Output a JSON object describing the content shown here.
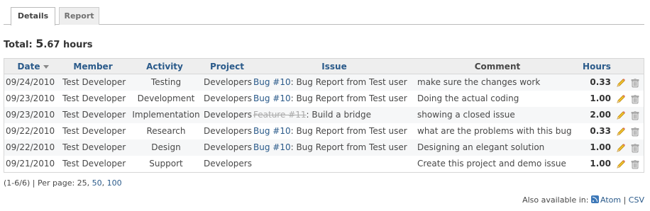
{
  "tabs": [
    {
      "label": "Details",
      "selected": true
    },
    {
      "label": "Report",
      "selected": false
    }
  ],
  "total": {
    "label": "Total:",
    "value_int": "5",
    "value_dec": ".67",
    "unit": "hours"
  },
  "table": {
    "headers": {
      "date": "Date",
      "member": "Member",
      "activity": "Activity",
      "project": "Project",
      "issue": "Issue",
      "comment": "Comment",
      "hours": "Hours"
    },
    "rows": [
      {
        "date": "09/24/2010",
        "member": "Test Developer",
        "activity": "Testing",
        "project": "Developers",
        "issue_link": "Bug #10",
        "issue_title": ": Bug Report from Test user",
        "comment": "make sure the changes work",
        "hours": "0.33"
      },
      {
        "date": "09/23/2010",
        "member": "Test Developer",
        "activity": "Development",
        "project": "Developers",
        "issue_link": "Bug #10",
        "issue_title": ": Bug Report from Test user",
        "comment": "Doing the actual coding",
        "hours": "1.00"
      },
      {
        "date": "09/23/2010",
        "member": "Test Developer",
        "activity": "Implementation",
        "project": "Developers",
        "issue_link": "Feature #11",
        "issue_title": ": Build a bridge",
        "comment": "showing a closed issue",
        "hours": "2.00"
      },
      {
        "date": "09/22/2010",
        "member": "Test Developer",
        "activity": "Research",
        "project": "Developers",
        "issue_link": "Bug #10",
        "issue_title": ": Bug Report from Test user",
        "comment": "what are the problems with this bug",
        "hours": "0.33"
      },
      {
        "date": "09/22/2010",
        "member": "Test Developer",
        "activity": "Design",
        "project": "Developers",
        "issue_link": "Bug #10",
        "issue_title": ": Bug Report from Test user",
        "comment": "Designing an elegant solution",
        "hours": "1.00"
      },
      {
        "date": "09/21/2010",
        "member": "Test Developer",
        "activity": "Support",
        "project": "Developers",
        "issue_link": "",
        "issue_title": "",
        "comment": "Create this project and demo issue",
        "hours": "1.00"
      }
    ]
  },
  "pagination": {
    "range": "(1-6/6)",
    "separator": " | Per page: ",
    "current": "25",
    "comma": ", ",
    "option_50": "50",
    "option_100": "100"
  },
  "formats": {
    "label": "Also available in:",
    "atom": "Atom",
    "separator": "|",
    "csv": "CSV"
  },
  "icons": {
    "edit": "edit-pencil-icon",
    "delete": "trash-icon",
    "feed": "feed-icon",
    "sort": "sort-desc-icon"
  },
  "colors": {
    "link": "#2a5a8a",
    "row_alt": "#f6f7f8",
    "header_bg": "#eeeeee"
  }
}
